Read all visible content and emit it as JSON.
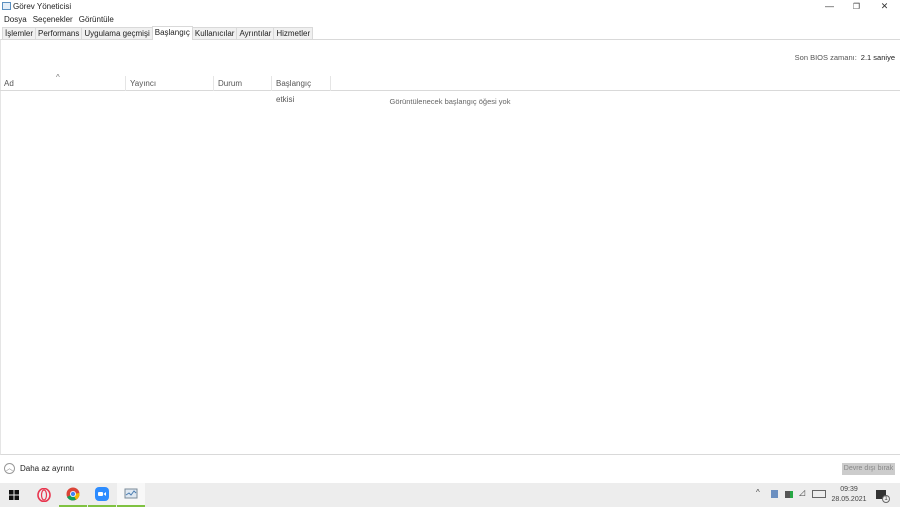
{
  "window": {
    "title": "Görev Yöneticisi",
    "minimize": "—",
    "restore": "❐",
    "close": "✕"
  },
  "menu": [
    "Dosya",
    "Seçenekler",
    "Görüntüle"
  ],
  "tabs": [
    {
      "label": "İşlemler"
    },
    {
      "label": "Performans"
    },
    {
      "label": "Uygulama geçmişi"
    },
    {
      "label": "Başlangıç",
      "active": true
    },
    {
      "label": "Kullanıcılar"
    },
    {
      "label": "Ayrıntılar"
    },
    {
      "label": "Hizmetler"
    }
  ],
  "bios": {
    "label": "Son BIOS zamanı:",
    "value": "2.1 saniye"
  },
  "columns": [
    "Ad",
    "Yayıncı",
    "Durum",
    "Başlangıç etkisi"
  ],
  "empty_message": "Görüntülenecek başlangıç öğesi yok",
  "footer": {
    "fewer_details": "Daha az ayrıntı",
    "disable_button": "Devre dışı bırak"
  },
  "taskbar": {
    "time": "09:39",
    "date": "28.05.2021",
    "notification_count": "1"
  }
}
